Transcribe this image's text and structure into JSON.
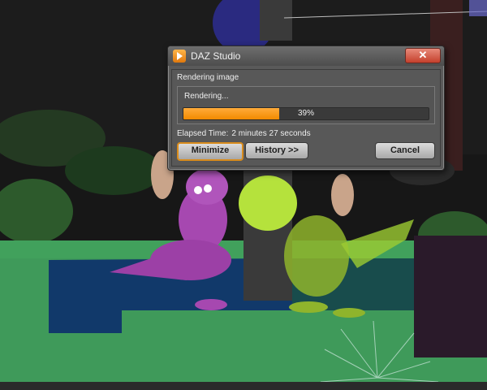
{
  "dialog": {
    "title": "DAZ Studio",
    "close_label": "✕",
    "heading": "Rendering image",
    "status": "Rendering...",
    "progress_percent": 39,
    "progress_label": "39%",
    "elapsed_label": "Elapsed Time:",
    "elapsed_value": "2 minutes 27 seconds",
    "buttons": {
      "minimize": "Minimize",
      "history": "History >>",
      "cancel": "Cancel"
    },
    "icon": "daz-studio-app-icon"
  },
  "colors": {
    "progress_fill": "#f28a00",
    "ground": "#3f9a5a",
    "purple_dragon": "#a648b0",
    "green_dragon": "#a6d63a"
  }
}
